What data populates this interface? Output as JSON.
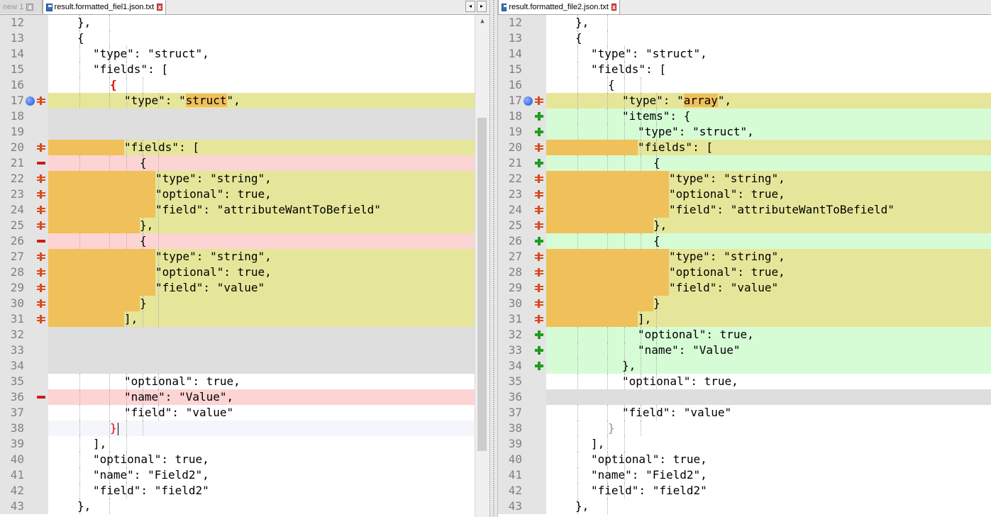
{
  "left": {
    "tabs": [
      {
        "label": "new 1",
        "state": "inactive"
      },
      {
        "label": "result.formatted_fiel1.json.txt",
        "state": "active"
      }
    ],
    "lines": [
      {
        "n": "12",
        "bg": "#ffffff",
        "text": "},"
      },
      {
        "n": "13",
        "bg": "#ffffff",
        "text": "{"
      },
      {
        "n": "14",
        "bg": "#ffffff",
        "text": "\"type\": \"struct\","
      },
      {
        "n": "15",
        "bg": "#ffffff",
        "text": "\"fields\": ["
      },
      {
        "n": "16",
        "bg": "#ffffff",
        "text": "{",
        "color": "#e00000",
        "bold": true
      },
      {
        "n": "17",
        "bg": "#e6e69a",
        "icon": "changed",
        "marker": true,
        "pre": "\"type\": \"",
        "hl": "struct",
        "post": "\","
      },
      {
        "n": "18",
        "bg": "#dedede",
        "text": ""
      },
      {
        "n": "19",
        "bg": "#dedede",
        "text": ""
      },
      {
        "n": "20",
        "bg": "#e6e69a",
        "icon": "changed",
        "text": "\"fields\": ["
      },
      {
        "n": "21",
        "bg": "#fdd4d4",
        "icon": "removed",
        "text": "{"
      },
      {
        "n": "22",
        "bg": "#e6e69a",
        "icon": "changed",
        "text": "\"type\": \"string\","
      },
      {
        "n": "23",
        "bg": "#e6e69a",
        "icon": "changed",
        "text": "\"optional\": true,"
      },
      {
        "n": "24",
        "bg": "#e6e69a",
        "icon": "changed",
        "text": "\"field\": \"attributeWantToBefield\""
      },
      {
        "n": "25",
        "bg": "#e6e69a",
        "icon": "changed",
        "text": "},"
      },
      {
        "n": "26",
        "bg": "#fdd4d4",
        "icon": "removed",
        "text": "{"
      },
      {
        "n": "27",
        "bg": "#e6e69a",
        "icon": "changed",
        "text": "\"type\": \"string\","
      },
      {
        "n": "28",
        "bg": "#e6e69a",
        "icon": "changed",
        "text": "\"optional\": true,"
      },
      {
        "n": "29",
        "bg": "#e6e69a",
        "icon": "changed",
        "text": "\"field\": \"value\""
      },
      {
        "n": "30",
        "bg": "#e6e69a",
        "icon": "changed",
        "text": "}"
      },
      {
        "n": "31",
        "bg": "#e6e69a",
        "icon": "changed",
        "text": "],"
      },
      {
        "n": "32",
        "bg": "#dedede",
        "text": ""
      },
      {
        "n": "33",
        "bg": "#dedede",
        "text": ""
      },
      {
        "n": "34",
        "bg": "#dedede",
        "text": ""
      },
      {
        "n": "35",
        "bg": "#ffffff",
        "text": "\"optional\": true,"
      },
      {
        "n": "36",
        "bg": "#fdd4d4",
        "icon": "removed",
        "text": "\"name\": \"Value\","
      },
      {
        "n": "37",
        "bg": "#ffffff",
        "text": "\"field\": \"value\""
      },
      {
        "n": "38",
        "bg": "#f4f6fc",
        "text": "}",
        "color": "#e00000",
        "caret": true
      },
      {
        "n": "39",
        "bg": "#ffffff",
        "text": "],"
      },
      {
        "n": "40",
        "bg": "#ffffff",
        "text": "\"optional\": true,"
      },
      {
        "n": "41",
        "bg": "#ffffff",
        "text": "\"name\": \"Field2\","
      },
      {
        "n": "42",
        "bg": "#ffffff",
        "text": "\"field\": \"field2\""
      },
      {
        "n": "43",
        "bg": "#ffffff",
        "text": "},"
      }
    ]
  },
  "right": {
    "tabs": [
      {
        "label": "result.formatted_file2.json.txt",
        "state": "active"
      }
    ],
    "lines": [
      {
        "n": "12",
        "bg": "#ffffff",
        "text": "},"
      },
      {
        "n": "13",
        "bg": "#ffffff",
        "text": "{"
      },
      {
        "n": "14",
        "bg": "#ffffff",
        "text": "\"type\": \"struct\","
      },
      {
        "n": "15",
        "bg": "#ffffff",
        "text": "\"fields\": ["
      },
      {
        "n": "16",
        "bg": "#ffffff",
        "text": "{"
      },
      {
        "n": "17",
        "bg": "#e6e69a",
        "icon": "changed",
        "marker": true,
        "pre": "\"type\": \"",
        "hl": "array",
        "post": "\","
      },
      {
        "n": "18",
        "bg": "#d6fcd6",
        "icon": "added",
        "text": "\"items\": {"
      },
      {
        "n": "19",
        "bg": "#d6fcd6",
        "icon": "added",
        "text": "\"type\": \"struct\","
      },
      {
        "n": "20",
        "bg": "#e6e69a",
        "icon": "changed",
        "text": "\"fields\": ["
      },
      {
        "n": "21",
        "bg": "#d6fcd6",
        "icon": "added",
        "text": "{"
      },
      {
        "n": "22",
        "bg": "#e6e69a",
        "icon": "changed",
        "text": "\"type\": \"string\","
      },
      {
        "n": "23",
        "bg": "#e6e69a",
        "icon": "changed",
        "text": "\"optional\": true,"
      },
      {
        "n": "24",
        "bg": "#e6e69a",
        "icon": "changed",
        "text": "\"field\": \"attributeWantToBefield\""
      },
      {
        "n": "25",
        "bg": "#e6e69a",
        "icon": "changed",
        "text": "},"
      },
      {
        "n": "26",
        "bg": "#d6fcd6",
        "icon": "added",
        "text": "{"
      },
      {
        "n": "27",
        "bg": "#e6e69a",
        "icon": "changed",
        "text": "\"type\": \"string\","
      },
      {
        "n": "28",
        "bg": "#e6e69a",
        "icon": "changed",
        "text": "\"optional\": true,"
      },
      {
        "n": "29",
        "bg": "#e6e69a",
        "icon": "changed",
        "text": "\"field\": \"value\""
      },
      {
        "n": "30",
        "bg": "#e6e69a",
        "icon": "changed",
        "text": "}"
      },
      {
        "n": "31",
        "bg": "#e6e69a",
        "icon": "changed",
        "text": "],"
      },
      {
        "n": "32",
        "bg": "#d6fcd6",
        "icon": "added",
        "text": "\"optional\": true,"
      },
      {
        "n": "33",
        "bg": "#d6fcd6",
        "icon": "added",
        "text": "\"name\": \"Value\""
      },
      {
        "n": "34",
        "bg": "#d6fcd6",
        "icon": "added",
        "text": "},"
      },
      {
        "n": "35",
        "bg": "#ffffff",
        "text": "\"optional\": true,"
      },
      {
        "n": "36",
        "bg": "#dedede",
        "text": ""
      },
      {
        "n": "37",
        "bg": "#ffffff",
        "text": "\"field\": \"value\""
      },
      {
        "n": "38",
        "bg": "#ffffff",
        "text": "}",
        "color": "#909090"
      },
      {
        "n": "39",
        "bg": "#ffffff",
        "text": "],"
      },
      {
        "n": "40",
        "bg": "#ffffff",
        "text": "\"optional\": true,"
      },
      {
        "n": "41",
        "bg": "#ffffff",
        "text": "\"name\": \"Field2\","
      },
      {
        "n": "42",
        "bg": "#ffffff",
        "text": "\"field\": \"field2\""
      },
      {
        "n": "43",
        "bg": "#ffffff",
        "text": "},"
      }
    ]
  },
  "colors": {
    "changed_line": "#e6e69a",
    "changed_word": "#f0c05a",
    "removed_line": "#fdd4d4",
    "added_line": "#d6fcd6",
    "placeholder_line": "#dedede",
    "changed_icon": "#d94a1a",
    "removed_icon": "#d01818",
    "added_icon": "#1e9e1e",
    "bookmark_marker": "#1e4ed8"
  },
  "icons": {
    "changed": "diff-changed-icon",
    "removed": "diff-removed-icon",
    "added": "diff-added-icon",
    "marker": "bookmark-marker-icon",
    "save": "file-saved-icon",
    "close": "close-tab-icon"
  }
}
